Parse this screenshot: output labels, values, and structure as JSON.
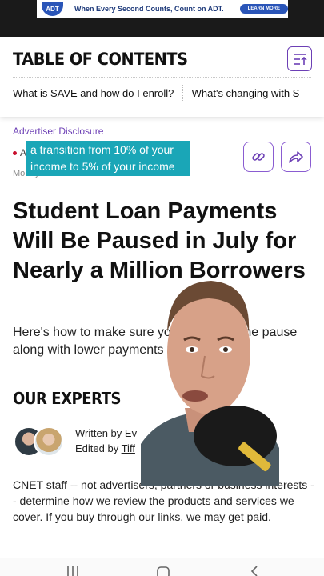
{
  "ad": {
    "logo": "ADT",
    "text": "When Every Second Counts, Count on ADT.",
    "button": "LEARN MORE"
  },
  "toc": {
    "title": "TABLE OF CONTENTS",
    "links": [
      "What is SAVE and how do I enroll?",
      "What's changing with S"
    ]
  },
  "article": {
    "disclosure": "Advertiser Disclosure",
    "author_initial": "A",
    "breadcrumb": "Money > Loans",
    "caption": "a transition from 10% of your income to 5% of your income",
    "headline": "Student Loan Payments Will Be Paused in July for Nearly a Million Borrowers",
    "dek": "Here's how to make sure you qualify for the pause along with lower payments going forward."
  },
  "experts": {
    "title": "OUR EXPERTS",
    "written_by_label": "Written by",
    "written_by_name": "Ev",
    "edited_by_label": "Edited by",
    "edited_by_name": "Tiff"
  },
  "staff_note": "CNET staff -- not advertisers, partners or business interests -- determine how we review the products and services we cover. If you buy through our links, we may get paid.",
  "colors": {
    "accent": "#6c3fb5",
    "caption_bg": "#1aa6b7"
  },
  "icons": [
    "list-arrow-icon",
    "link-icon",
    "share-icon",
    "recents-icon",
    "home-icon",
    "back-icon"
  ]
}
